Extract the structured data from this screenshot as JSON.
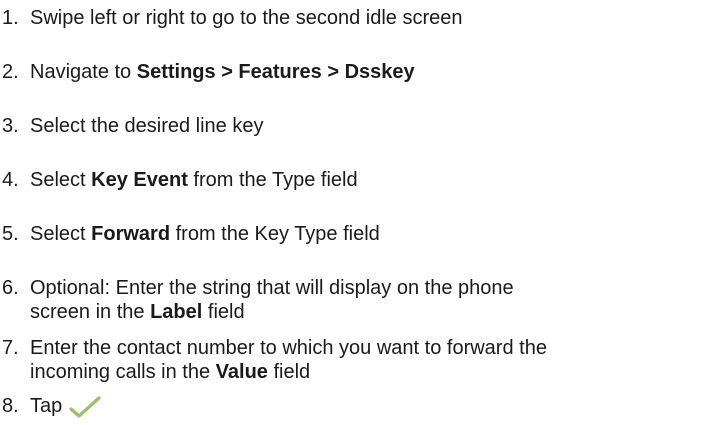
{
  "steps": [
    {
      "number": "1.",
      "text_parts": [
        "Swipe left or right to go to the second idle screen"
      ]
    },
    {
      "number": "2.",
      "text_parts": [
        "Navigate to ",
        "Settings > Features > Dsskey"
      ]
    },
    {
      "number": "3.",
      "text_parts": [
        "Select the desired line key"
      ]
    },
    {
      "number": "4.",
      "text_parts": [
        "Select ",
        "Key Event",
        " from the Type field"
      ]
    },
    {
      "number": "5.",
      "text_parts": [
        "Select ",
        "Forward",
        " from the Key Type field"
      ]
    },
    {
      "number": "6.",
      "line1": "Optional: Enter the string that will display on the phone",
      "line2_parts": [
        "screen in the ",
        "Label",
        " field"
      ]
    },
    {
      "number": "7.",
      "line1": "Enter the contact number to which you want to forward the",
      "line2_parts": [
        "incoming calls in the ",
        "Value",
        " field"
      ]
    },
    {
      "number": "8.",
      "text_parts": [
        "Tap"
      ],
      "icon": "checkmark-icon"
    }
  ],
  "colors": {
    "text": "#1a1a1a",
    "check": "#9bbf6a"
  }
}
